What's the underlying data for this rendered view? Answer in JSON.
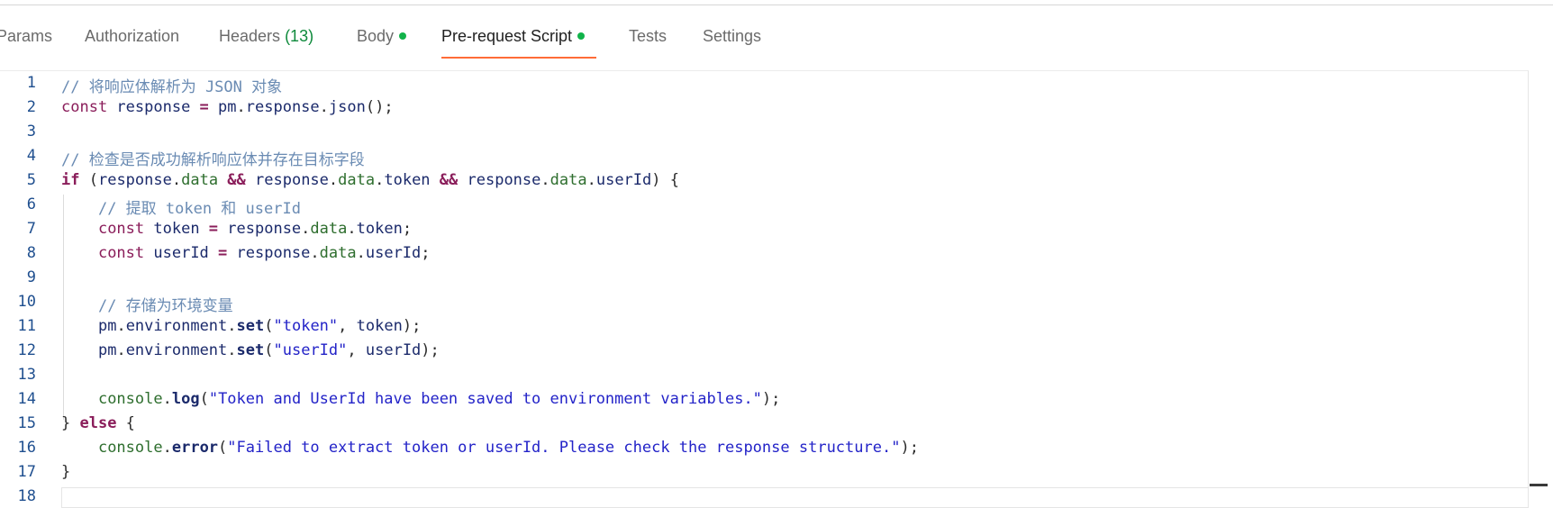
{
  "tabs": [
    {
      "label": "Params"
    },
    {
      "label": "Authorization"
    },
    {
      "label": "Headers",
      "count": "(13)"
    },
    {
      "label": "Body",
      "has_dot": true
    },
    {
      "label": "Pre-request Script",
      "has_dot": true,
      "active": true
    },
    {
      "label": "Tests"
    },
    {
      "label": "Settings"
    }
  ],
  "colors": {
    "active_tab_underline": "#ff6c37",
    "dot": "#11b34a",
    "count": "#0f8a3c"
  },
  "editor": {
    "line_numbers": [
      "1",
      "2",
      "3",
      "4",
      "5",
      "6",
      "7",
      "8",
      "9",
      "10",
      "11",
      "12",
      "13",
      "14",
      "15",
      "16",
      "17",
      "18"
    ],
    "lines": [
      [
        {
          "t": "// 将响应体解析为 JSON 对象",
          "c": "comment"
        }
      ],
      [
        {
          "t": "const ",
          "c": "kw"
        },
        {
          "t": "response",
          "c": "var"
        },
        {
          "t": " = ",
          "c": "op"
        },
        {
          "t": "pm",
          "c": "var"
        },
        {
          "t": ".",
          "c": "plain"
        },
        {
          "t": "response",
          "c": "var"
        },
        {
          "t": ".",
          "c": "plain"
        },
        {
          "t": "json",
          "c": "var"
        },
        {
          "t": "();",
          "c": "plain"
        }
      ],
      [],
      [
        {
          "t": "// 检查是否成功解析响应体并存在目标字段",
          "c": "comment"
        }
      ],
      [
        {
          "t": "if",
          "c": "kwb"
        },
        {
          "t": " (",
          "c": "plain"
        },
        {
          "t": "response",
          "c": "var"
        },
        {
          "t": ".",
          "c": "plain"
        },
        {
          "t": "data",
          "c": "prop"
        },
        {
          "t": " && ",
          "c": "op"
        },
        {
          "t": "response",
          "c": "var"
        },
        {
          "t": ".",
          "c": "plain"
        },
        {
          "t": "data",
          "c": "prop"
        },
        {
          "t": ".",
          "c": "plain"
        },
        {
          "t": "token",
          "c": "var"
        },
        {
          "t": " && ",
          "c": "op"
        },
        {
          "t": "response",
          "c": "var"
        },
        {
          "t": ".",
          "c": "plain"
        },
        {
          "t": "data",
          "c": "prop"
        },
        {
          "t": ".",
          "c": "plain"
        },
        {
          "t": "userId",
          "c": "var"
        },
        {
          "t": ") {",
          "c": "plain"
        }
      ],
      [
        {
          "t": "    "
        },
        {
          "t": "// 提取 token 和 userId",
          "c": "comment"
        }
      ],
      [
        {
          "t": "    "
        },
        {
          "t": "const ",
          "c": "kw"
        },
        {
          "t": "token",
          "c": "var"
        },
        {
          "t": " = ",
          "c": "op"
        },
        {
          "t": "response",
          "c": "var"
        },
        {
          "t": ".",
          "c": "plain"
        },
        {
          "t": "data",
          "c": "prop"
        },
        {
          "t": ".",
          "c": "plain"
        },
        {
          "t": "token",
          "c": "var"
        },
        {
          "t": ";",
          "c": "plain"
        }
      ],
      [
        {
          "t": "    "
        },
        {
          "t": "const ",
          "c": "kw"
        },
        {
          "t": "userId",
          "c": "var"
        },
        {
          "t": " = ",
          "c": "op"
        },
        {
          "t": "response",
          "c": "var"
        },
        {
          "t": ".",
          "c": "plain"
        },
        {
          "t": "data",
          "c": "prop"
        },
        {
          "t": ".",
          "c": "plain"
        },
        {
          "t": "userId",
          "c": "var"
        },
        {
          "t": ";",
          "c": "plain"
        }
      ],
      [],
      [
        {
          "t": "    "
        },
        {
          "t": "// 存储为环境变量",
          "c": "comment"
        }
      ],
      [
        {
          "t": "    "
        },
        {
          "t": "pm",
          "c": "var"
        },
        {
          "t": ".",
          "c": "plain"
        },
        {
          "t": "environment",
          "c": "var"
        },
        {
          "t": ".",
          "c": "plain"
        },
        {
          "t": "set",
          "c": "fn"
        },
        {
          "t": "(",
          "c": "plain"
        },
        {
          "t": "\"token\"",
          "c": "str"
        },
        {
          "t": ", ",
          "c": "plain"
        },
        {
          "t": "token",
          "c": "var"
        },
        {
          "t": ");",
          "c": "plain"
        }
      ],
      [
        {
          "t": "    "
        },
        {
          "t": "pm",
          "c": "var"
        },
        {
          "t": ".",
          "c": "plain"
        },
        {
          "t": "environment",
          "c": "var"
        },
        {
          "t": ".",
          "c": "plain"
        },
        {
          "t": "set",
          "c": "fn"
        },
        {
          "t": "(",
          "c": "plain"
        },
        {
          "t": "\"userId\"",
          "c": "str"
        },
        {
          "t": ", ",
          "c": "plain"
        },
        {
          "t": "userId",
          "c": "var"
        },
        {
          "t": ");",
          "c": "plain"
        }
      ],
      [],
      [
        {
          "t": "    "
        },
        {
          "t": "console",
          "c": "console"
        },
        {
          "t": ".",
          "c": "plain"
        },
        {
          "t": "log",
          "c": "fn"
        },
        {
          "t": "(",
          "c": "plain"
        },
        {
          "t": "\"Token and UserId have been saved to environment variables.\"",
          "c": "str"
        },
        {
          "t": ");",
          "c": "plain"
        }
      ],
      [
        {
          "t": "} ",
          "c": "plain"
        },
        {
          "t": "else",
          "c": "kwb"
        },
        {
          "t": " {",
          "c": "plain"
        }
      ],
      [
        {
          "t": "    "
        },
        {
          "t": "console",
          "c": "console"
        },
        {
          "t": ".",
          "c": "plain"
        },
        {
          "t": "error",
          "c": "fn"
        },
        {
          "t": "(",
          "c": "plain"
        },
        {
          "t": "\"Failed to extract token or userId. Please check the response structure.\"",
          "c": "str"
        },
        {
          "t": ");",
          "c": "plain"
        }
      ],
      [
        {
          "t": "}",
          "c": "plain"
        }
      ],
      []
    ]
  }
}
